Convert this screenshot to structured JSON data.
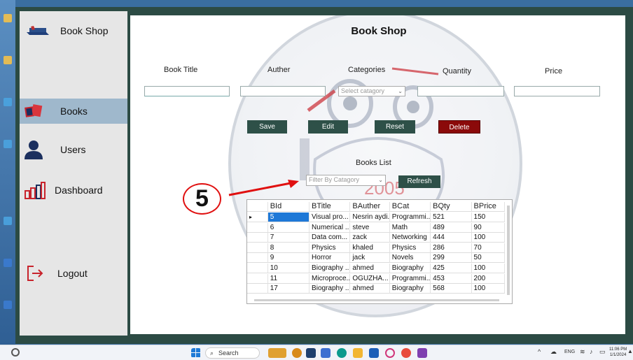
{
  "sidebar": {
    "app_title": "Book Shop",
    "items": [
      {
        "label": "Books",
        "icon": "books-icon",
        "active": true
      },
      {
        "label": "Users",
        "icon": "user-icon",
        "active": false
      },
      {
        "label": "Dashboard",
        "icon": "bar-chart-icon",
        "active": false
      },
      {
        "label": "Logout",
        "icon": "logout-icon",
        "active": false
      }
    ]
  },
  "main": {
    "title": "Book Shop",
    "watermark_year": "2005",
    "labels": {
      "book_title": "Book Title",
      "auther": "Auther",
      "categories": "Categories",
      "quantity": "Quantity",
      "price": "Price"
    },
    "category_select": "Select catagory",
    "buttons": {
      "save": "Save",
      "edit": "Edit",
      "reset": "Reset",
      "delete": "Delete",
      "refresh": "Refresh"
    },
    "books_list_label": "Books List",
    "filter_select": "Filter By Catagory",
    "grid": {
      "columns": [
        "BId",
        "BTitle",
        "BAuther",
        "BCat",
        "BQty",
        "BPrice"
      ],
      "rows": [
        [
          "5",
          "Visual pro...",
          "Nesrin aydi...",
          "Programmi...",
          "521",
          "150"
        ],
        [
          "6",
          "Numerical ...",
          "steve",
          "Math",
          "489",
          "90"
        ],
        [
          "7",
          "Data com...",
          "zack",
          "Networking",
          "444",
          "100"
        ],
        [
          "8",
          "Physics",
          "khaled",
          "Physics",
          "286",
          "70"
        ],
        [
          "9",
          "Horror",
          "jack",
          "Novels",
          "299",
          "50"
        ],
        [
          "10",
          "Biography ...",
          "ahmed",
          "Biography",
          "425",
          "100"
        ],
        [
          "11",
          "Microproce...",
          "OGUZHA...",
          "Programmi...",
          "453",
          "200"
        ],
        [
          "17",
          "Biography ...",
          "ahmed",
          "Biography",
          "568",
          "100"
        ]
      ]
    }
  },
  "annotation": {
    "step": "5",
    "color": "#e01010"
  },
  "taskbar": {
    "search_placeholder": "Search",
    "lang": "ENG",
    "time": "11:06 PM",
    "date": "1/1/2024"
  },
  "colors": {
    "frame": "#2c4b44",
    "button_dark": "#2e5048",
    "button_delete": "#8b0a0a",
    "nav_active": "#9fb8cc"
  }
}
